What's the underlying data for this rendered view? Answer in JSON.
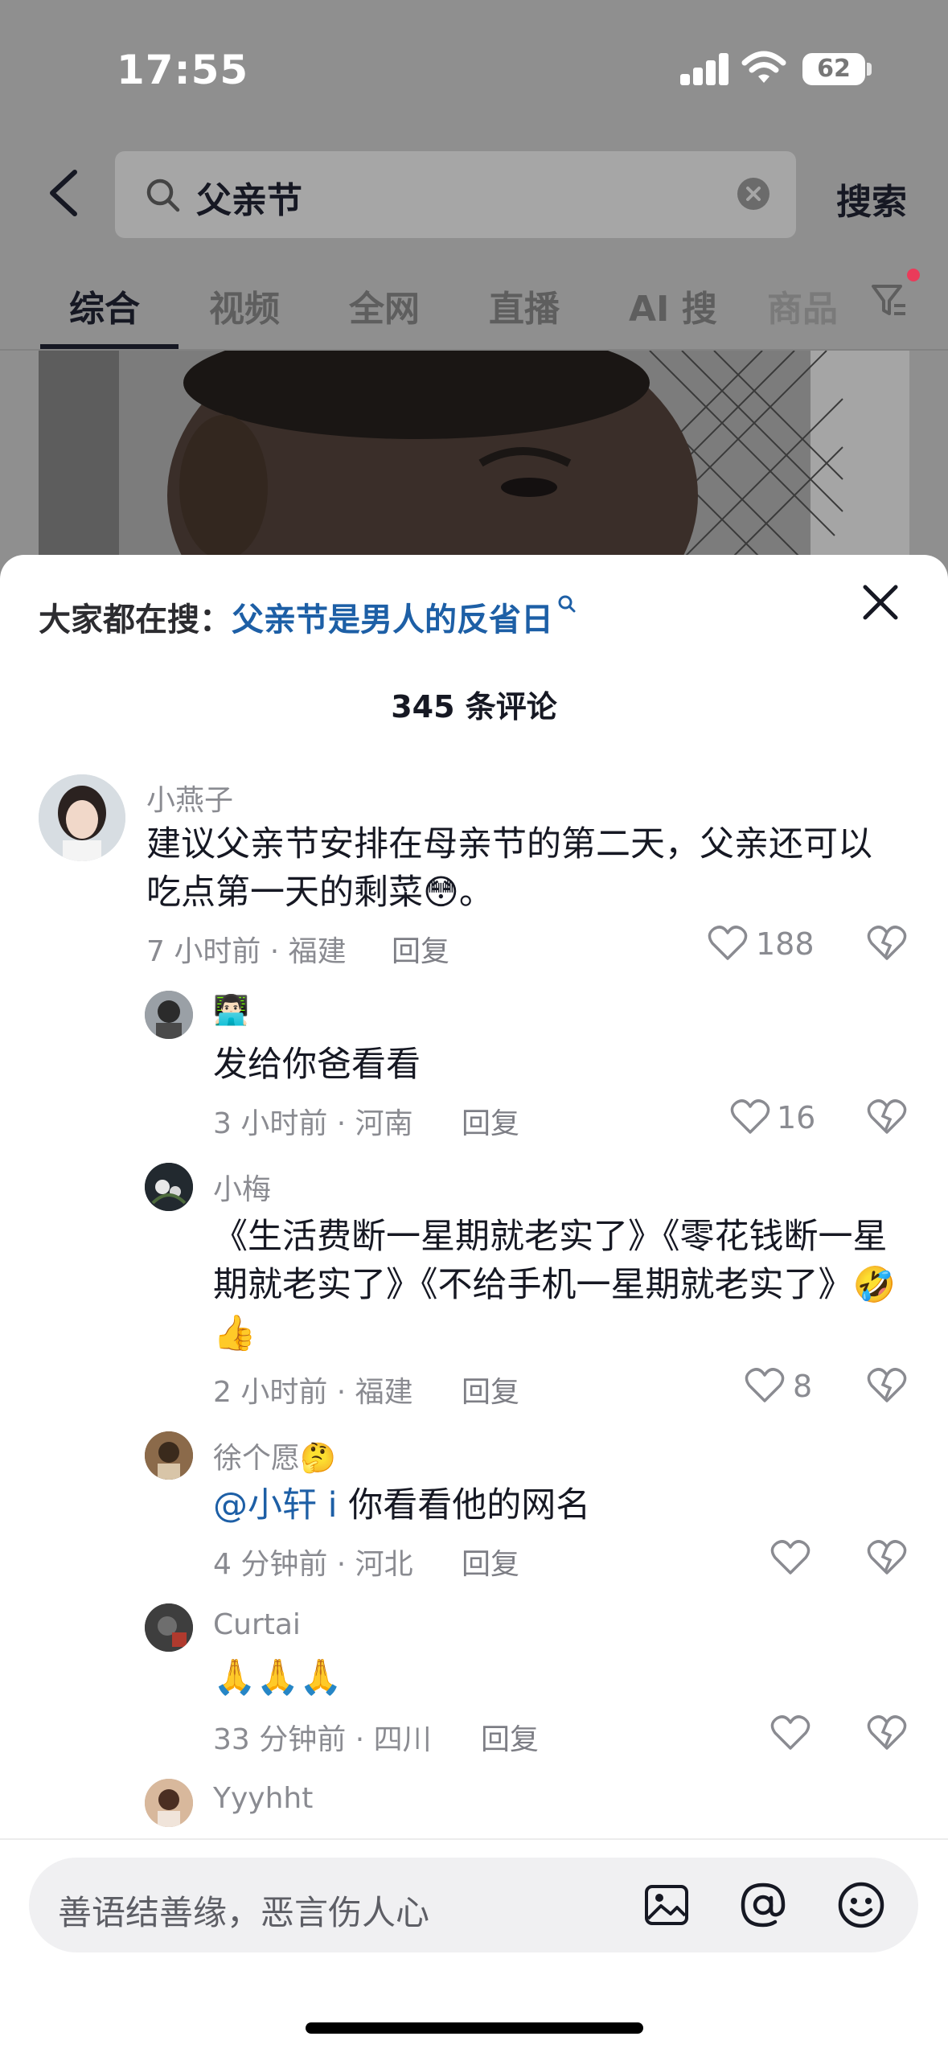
{
  "status_bar": {
    "time": "17:55",
    "battery": "62"
  },
  "search": {
    "query": "父亲节",
    "button": "搜索"
  },
  "tabs": [
    "综合",
    "视频",
    "全网",
    "直播",
    "AI 搜",
    "商品"
  ],
  "trending": {
    "prefix": "大家都在搜：",
    "link": "父亲节是男人的反省日"
  },
  "comment_count": "345 条评论",
  "comments": [
    {
      "user": "小燕子",
      "text": "建议父亲节安排在母亲节的第二天，父亲还可以吃点第一天的剩菜😳。",
      "meta": "7 小时前 · 福建",
      "reply": "回复",
      "likes": "188"
    },
    {
      "user": "👨🏻‍💻",
      "text": "发给你爸看看",
      "meta": "3 小时前 · 河南",
      "reply": "回复",
      "likes": "16"
    },
    {
      "user": "小梅",
      "text": "《生活费断一星期就老实了》《零花钱断一星期就老实了》《不给手机一星期就老实了》🤣👍",
      "meta": "2 小时前 · 福建",
      "reply": "回复",
      "likes": "8"
    },
    {
      "user": "徐个愿🤔",
      "mention": "@小轩 i",
      "text": " 你看看他的网名",
      "meta": "4 分钟前 · 河北",
      "reply": "回复",
      "likes": ""
    },
    {
      "user": "Curtai",
      "text": "🙏🙏🙏",
      "meta": "33 分钟前 · 四川",
      "reply": "回复",
      "likes": ""
    },
    {
      "user": "Yyyhht",
      "text": "",
      "meta": "",
      "reply": "",
      "likes": ""
    }
  ],
  "input": {
    "placeholder": "善语结善缘，恶言伤人心"
  },
  "colors": {
    "link": "#1d5fa6",
    "text": "#161823",
    "muted": "#8a8b91",
    "badge": "#ea3b5a"
  }
}
